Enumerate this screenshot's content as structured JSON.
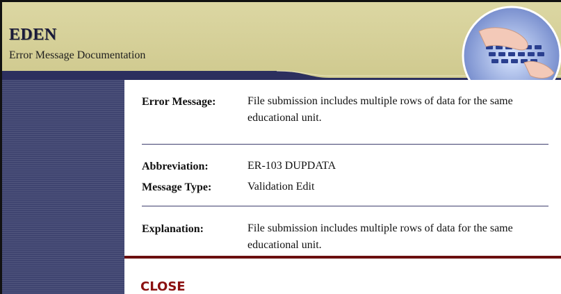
{
  "header": {
    "title": "EDEN",
    "subtitle": "Error Message Documentation",
    "photo_icon": "hands-on-keyboard-photo"
  },
  "details": {
    "error_message_label": "Error Message:",
    "error_message_value": "File submission includes multiple rows of data for the same educational unit.",
    "abbreviation_label": "Abbreviation:",
    "abbreviation_value": "ER-103 DUPDATA",
    "message_type_label": "Message Type:",
    "message_type_value": "Validation Edit",
    "explanation_label": "Explanation:",
    "explanation_value": "File submission includes multiple rows of data for the same educational unit."
  },
  "actions": {
    "close_label": "CLOSE"
  },
  "colors": {
    "header_bg": "#d6d19a",
    "sidebar_bg": "#3f4470",
    "navy": "#2c2f5e",
    "accent_red": "#8b1010"
  }
}
